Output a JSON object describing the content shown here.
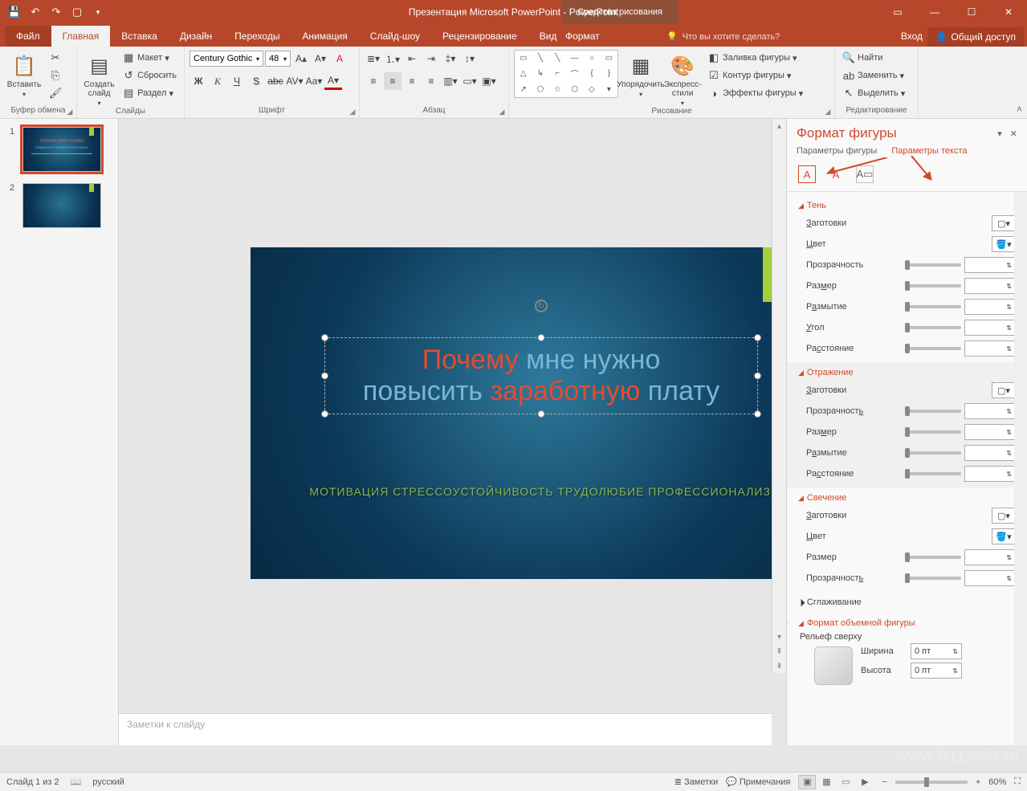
{
  "titlebar": {
    "title": "Презентация Microsoft PowerPoint - PowerPoint",
    "drawing_tools": "Средства рисования"
  },
  "tabs": {
    "file": "Файл",
    "home": "Главная",
    "insert": "Вставка",
    "design": "Дизайн",
    "transitions": "Переходы",
    "animations": "Анимация",
    "slideshow": "Слайд-шоу",
    "review": "Рецензирование",
    "view": "Вид",
    "format": "Формат",
    "tellme": "Что вы хотите сделать?",
    "signin": "Вход",
    "share": "Общий доступ"
  },
  "ribbon": {
    "clipboard": {
      "label": "Буфер обмена",
      "paste": "Вставить"
    },
    "slides": {
      "label": "Слайды",
      "new_slide": "Создать слайд",
      "layout": "Макет",
      "reset": "Сбросить",
      "section": "Раздел"
    },
    "font": {
      "label": "Шрифт",
      "name": "Century Gothic",
      "size": "48"
    },
    "paragraph": {
      "label": "Абзац"
    },
    "drawing": {
      "label": "Рисование",
      "arrange": "Упорядочить",
      "quick_styles": "Экспресс-стили",
      "shape_fill": "Заливка фигуры",
      "shape_outline": "Контур фигуры",
      "shape_effects": "Эффекты фигуры"
    },
    "editing": {
      "label": "Редактирование",
      "find": "Найти",
      "replace": "Заменить",
      "select": "Выделить"
    }
  },
  "slide": {
    "title_l1_red": "Почему ",
    "title_l1_blue": "мне нужно",
    "title_l2_blue1": "повысить ",
    "title_l2_red": "заработную ",
    "title_l2_blue2": "плату",
    "subtitle": "МОТИВАЦИЯ СТРЕССОУСТОЙЧИВОСТЬ ТРУДОЛЮБИЕ ПРОФЕССИОНАЛИЗМ"
  },
  "notes_placeholder": "Заметки к слайду",
  "pane": {
    "title": "Формат фигуры",
    "tab_shape": "Параметры фигуры",
    "tab_text": "Параметры текста",
    "sections": {
      "shadow": "Тень",
      "reflection": "Отражение",
      "glow": "Свечение",
      "soft_edges": "Сглаживание",
      "format_3d": "Формат объемной фигуры",
      "bevel_top": "Рельеф сверху"
    },
    "props": {
      "presets": "Заготовки",
      "color": "Цвет",
      "transparency": "Прозрачность",
      "size": "Размер",
      "blur": "Размытие",
      "angle": "Угол",
      "distance": "Расстояние",
      "width": "Ширина",
      "height": "Высота",
      "pt0": "0 пт"
    }
  },
  "status": {
    "slide_count": "Слайд 1 из 2",
    "lang": "русский",
    "notes": "Заметки",
    "comments": "Примечания",
    "zoom": "60%"
  },
  "watermark": "www.911-win.ru"
}
